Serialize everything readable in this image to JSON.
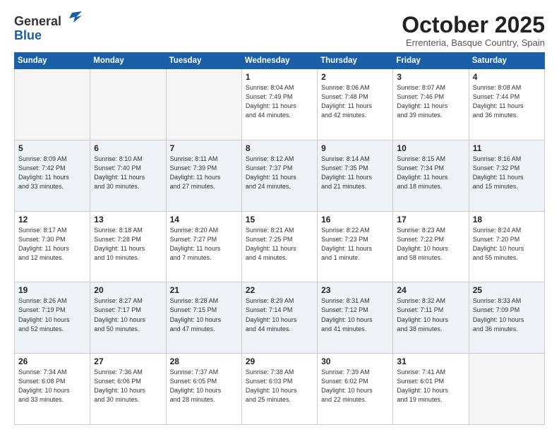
{
  "header": {
    "logo_line1": "General",
    "logo_line2": "Blue",
    "month": "October 2025",
    "location": "Errenteria, Basque Country, Spain"
  },
  "weekdays": [
    "Sunday",
    "Monday",
    "Tuesday",
    "Wednesday",
    "Thursday",
    "Friday",
    "Saturday"
  ],
  "weeks": [
    [
      {
        "day": "",
        "info": ""
      },
      {
        "day": "",
        "info": ""
      },
      {
        "day": "",
        "info": ""
      },
      {
        "day": "1",
        "info": "Sunrise: 8:04 AM\nSunset: 7:49 PM\nDaylight: 11 hours\nand 44 minutes."
      },
      {
        "day": "2",
        "info": "Sunrise: 8:06 AM\nSunset: 7:48 PM\nDaylight: 11 hours\nand 42 minutes."
      },
      {
        "day": "3",
        "info": "Sunrise: 8:07 AM\nSunset: 7:46 PM\nDaylight: 11 hours\nand 39 minutes."
      },
      {
        "day": "4",
        "info": "Sunrise: 8:08 AM\nSunset: 7:44 PM\nDaylight: 11 hours\nand 36 minutes."
      }
    ],
    [
      {
        "day": "5",
        "info": "Sunrise: 8:09 AM\nSunset: 7:42 PM\nDaylight: 11 hours\nand 33 minutes."
      },
      {
        "day": "6",
        "info": "Sunrise: 8:10 AM\nSunset: 7:40 PM\nDaylight: 11 hours\nand 30 minutes."
      },
      {
        "day": "7",
        "info": "Sunrise: 8:11 AM\nSunset: 7:39 PM\nDaylight: 11 hours\nand 27 minutes."
      },
      {
        "day": "8",
        "info": "Sunrise: 8:12 AM\nSunset: 7:37 PM\nDaylight: 11 hours\nand 24 minutes."
      },
      {
        "day": "9",
        "info": "Sunrise: 8:14 AM\nSunset: 7:35 PM\nDaylight: 11 hours\nand 21 minutes."
      },
      {
        "day": "10",
        "info": "Sunrise: 8:15 AM\nSunset: 7:34 PM\nDaylight: 11 hours\nand 18 minutes."
      },
      {
        "day": "11",
        "info": "Sunrise: 8:16 AM\nSunset: 7:32 PM\nDaylight: 11 hours\nand 15 minutes."
      }
    ],
    [
      {
        "day": "12",
        "info": "Sunrise: 8:17 AM\nSunset: 7:30 PM\nDaylight: 11 hours\nand 12 minutes."
      },
      {
        "day": "13",
        "info": "Sunrise: 8:18 AM\nSunset: 7:28 PM\nDaylight: 11 hours\nand 10 minutes."
      },
      {
        "day": "14",
        "info": "Sunrise: 8:20 AM\nSunset: 7:27 PM\nDaylight: 11 hours\nand 7 minutes."
      },
      {
        "day": "15",
        "info": "Sunrise: 8:21 AM\nSunset: 7:25 PM\nDaylight: 11 hours\nand 4 minutes."
      },
      {
        "day": "16",
        "info": "Sunrise: 8:22 AM\nSunset: 7:23 PM\nDaylight: 11 hours\nand 1 minute."
      },
      {
        "day": "17",
        "info": "Sunrise: 8:23 AM\nSunset: 7:22 PM\nDaylight: 10 hours\nand 58 minutes."
      },
      {
        "day": "18",
        "info": "Sunrise: 8:24 AM\nSunset: 7:20 PM\nDaylight: 10 hours\nand 55 minutes."
      }
    ],
    [
      {
        "day": "19",
        "info": "Sunrise: 8:26 AM\nSunset: 7:19 PM\nDaylight: 10 hours\nand 52 minutes."
      },
      {
        "day": "20",
        "info": "Sunrise: 8:27 AM\nSunset: 7:17 PM\nDaylight: 10 hours\nand 50 minutes."
      },
      {
        "day": "21",
        "info": "Sunrise: 8:28 AM\nSunset: 7:15 PM\nDaylight: 10 hours\nand 47 minutes."
      },
      {
        "day": "22",
        "info": "Sunrise: 8:29 AM\nSunset: 7:14 PM\nDaylight: 10 hours\nand 44 minutes."
      },
      {
        "day": "23",
        "info": "Sunrise: 8:31 AM\nSunset: 7:12 PM\nDaylight: 10 hours\nand 41 minutes."
      },
      {
        "day": "24",
        "info": "Sunrise: 8:32 AM\nSunset: 7:11 PM\nDaylight: 10 hours\nand 38 minutes."
      },
      {
        "day": "25",
        "info": "Sunrise: 8:33 AM\nSunset: 7:09 PM\nDaylight: 10 hours\nand 36 minutes."
      }
    ],
    [
      {
        "day": "26",
        "info": "Sunrise: 7:34 AM\nSunset: 6:08 PM\nDaylight: 10 hours\nand 33 minutes."
      },
      {
        "day": "27",
        "info": "Sunrise: 7:36 AM\nSunset: 6:06 PM\nDaylight: 10 hours\nand 30 minutes."
      },
      {
        "day": "28",
        "info": "Sunrise: 7:37 AM\nSunset: 6:05 PM\nDaylight: 10 hours\nand 28 minutes."
      },
      {
        "day": "29",
        "info": "Sunrise: 7:38 AM\nSunset: 6:03 PM\nDaylight: 10 hours\nand 25 minutes."
      },
      {
        "day": "30",
        "info": "Sunrise: 7:39 AM\nSunset: 6:02 PM\nDaylight: 10 hours\nand 22 minutes."
      },
      {
        "day": "31",
        "info": "Sunrise: 7:41 AM\nSunset: 6:01 PM\nDaylight: 10 hours\nand 19 minutes."
      },
      {
        "day": "",
        "info": ""
      }
    ]
  ]
}
